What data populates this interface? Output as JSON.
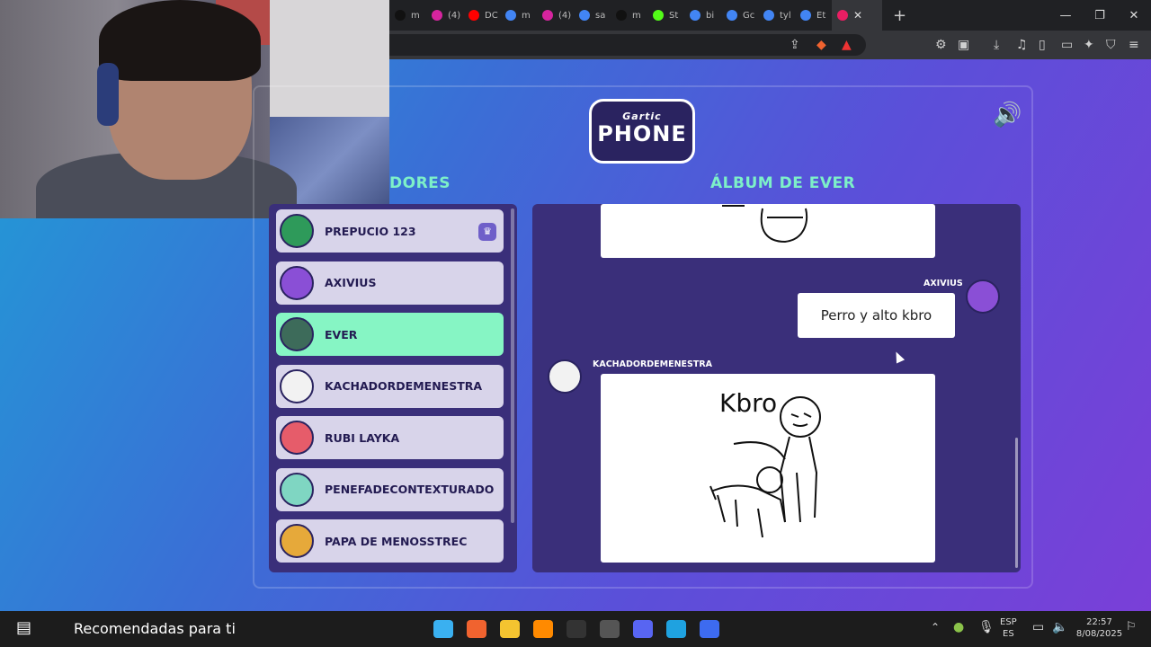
{
  "browser": {
    "tabs": [
      {
        "label": "m",
        "color": "#111"
      },
      {
        "label": "(4)",
        "color": "#d6249f"
      },
      {
        "label": "DC",
        "color": "#ff0000"
      },
      {
        "label": "m",
        "color": "#4285f4"
      },
      {
        "label": "(4)",
        "color": "#d6249f"
      },
      {
        "label": "sa",
        "color": "#4285f4"
      },
      {
        "label": "m",
        "color": "#111"
      },
      {
        "label": "St",
        "color": "#53fc18"
      },
      {
        "label": "bi",
        "color": "#4285f4"
      },
      {
        "label": "Gc",
        "color": "#4285f4"
      },
      {
        "label": "tyl",
        "color": "#4285f4"
      },
      {
        "label": "Et",
        "color": "#4285f4"
      }
    ],
    "active_tab_icon": "phone-icon",
    "new_tab": "+",
    "window_controls": {
      "minimize": "—",
      "maximize": "❐",
      "close": "✕"
    }
  },
  "game": {
    "logo_top": "Gartic",
    "logo_bottom": "PHONE",
    "players_header": "DORES",
    "album_header": "ÁLBUM DE EVER",
    "players": [
      {
        "name": "PREPUCIO 123",
        "color": "#2e9a5a",
        "host": true,
        "active": false
      },
      {
        "name": "AXIVIUS",
        "color": "#8a4fd6",
        "host": false,
        "active": false
      },
      {
        "name": "EVER",
        "color": "#3d6b5a",
        "host": false,
        "active": true
      },
      {
        "name": "KACHADORDEMENESTRA",
        "color": "#f2f2f2",
        "host": false,
        "active": false
      },
      {
        "name": "RUBI LAYKA",
        "color": "#e65c6a",
        "host": false,
        "active": false
      },
      {
        "name": "PENEFADECONTEXTURADO",
        "color": "#7fd6c2",
        "host": false,
        "active": false
      },
      {
        "name": "PAPA DE MENOSSTREC",
        "color": "#e6a93a",
        "host": false,
        "active": false
      }
    ],
    "album": {
      "axivius_name": "AXIVIUS",
      "axivius_text": "Perro y alto kbro",
      "kachador_name": "KACHADORDEMENESTRA",
      "drawing_text": "Kbro"
    }
  },
  "taskbar": {
    "recommended": "Recomendadas para ti",
    "lang_top": "ESP",
    "lang_bottom": "ES",
    "time": "22:57",
    "date": "8/08/2025"
  }
}
